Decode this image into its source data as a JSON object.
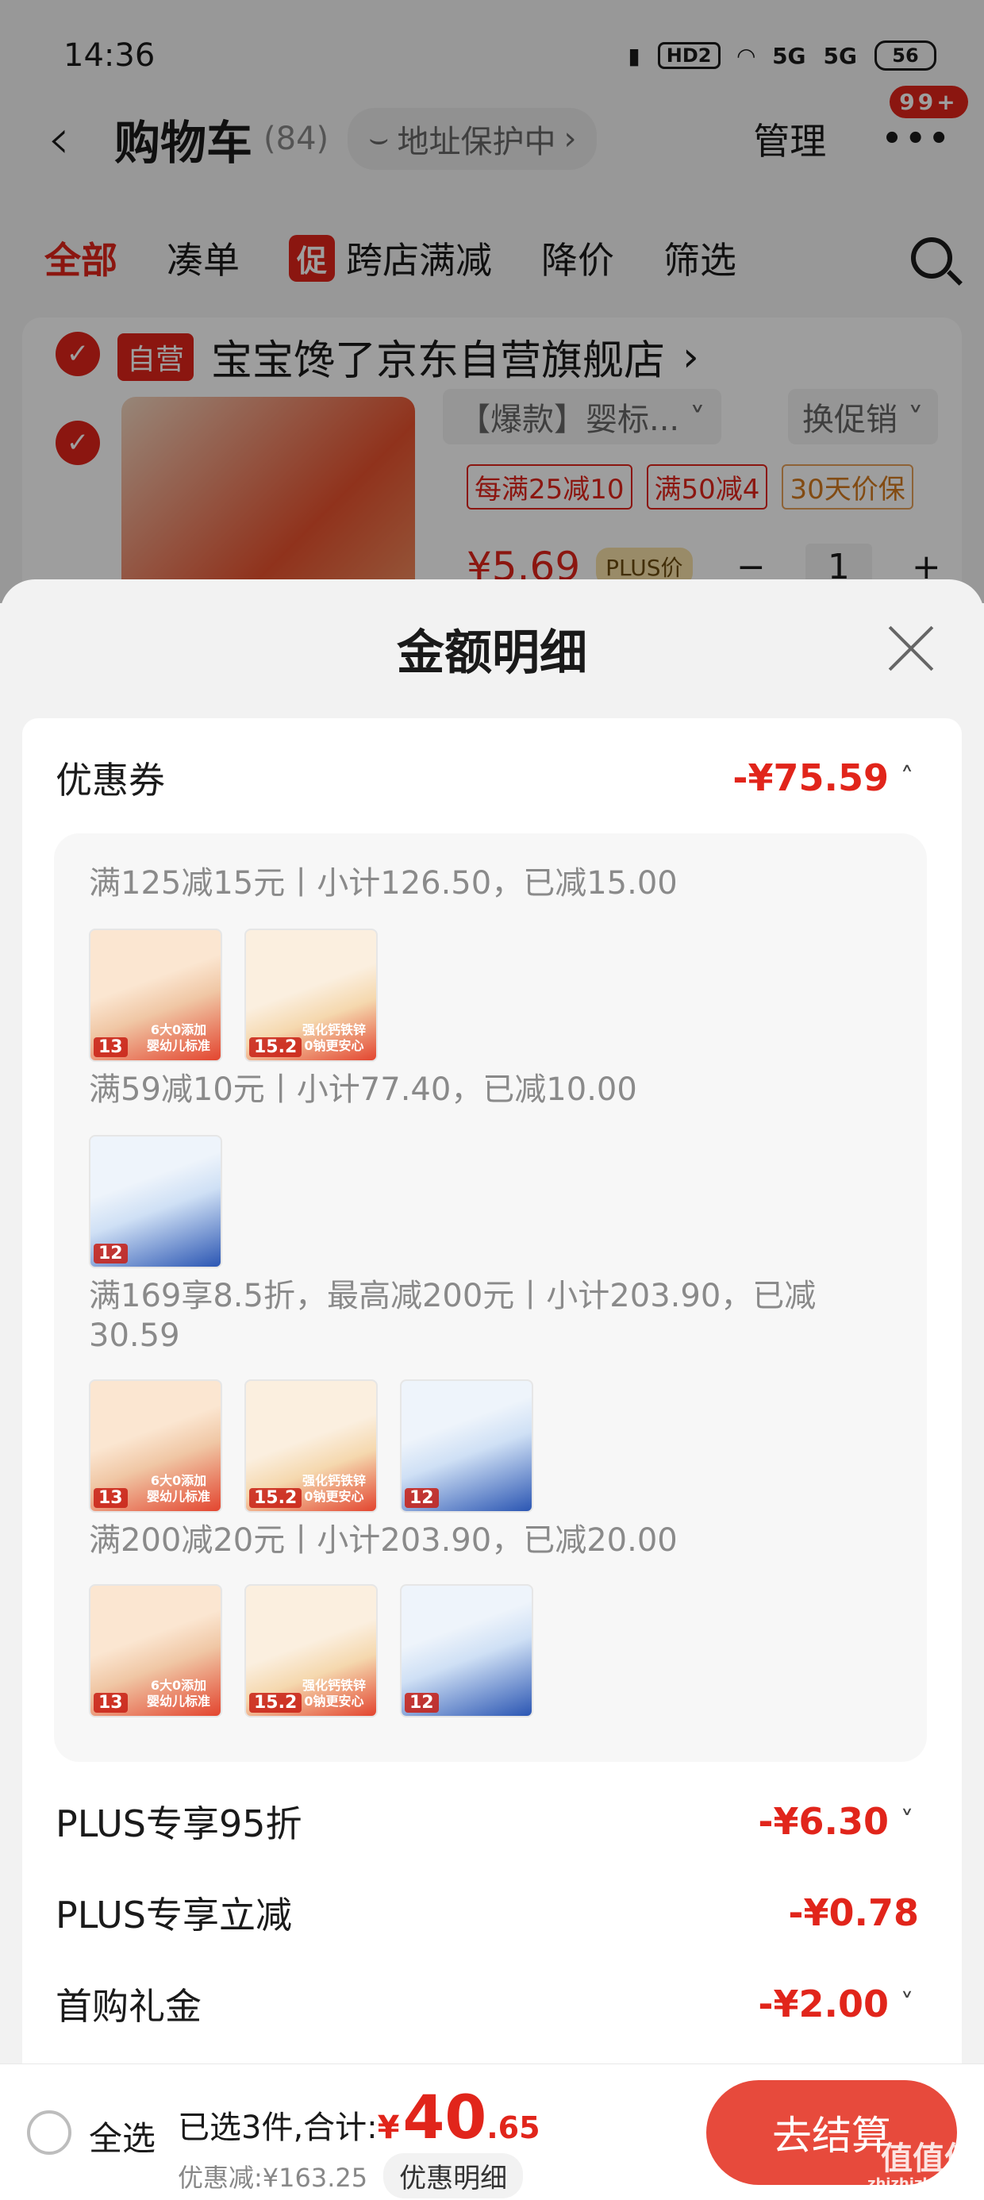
{
  "status_bar": {
    "time": "14:36",
    "hd": "HD2",
    "net1": "5G",
    "net2": "5G",
    "battery": "56"
  },
  "nav": {
    "title": "购物车",
    "count": "(84)",
    "address": "地址保护中",
    "manage": "管理",
    "badge": "99+"
  },
  "tabs": [
    {
      "label": "全部"
    },
    {
      "label": "凑单"
    },
    {
      "label": "跨店满减",
      "tag": "促"
    },
    {
      "label": "降价"
    },
    {
      "label": "筛选"
    }
  ],
  "store": {
    "self_tag": "自营",
    "name": "宝宝馋了京东自营旗舰店",
    "spec": "【爆款】婴标...",
    "swap": "换促销",
    "coupon_tags": [
      "每满25减10",
      "满50减4",
      "30天价保"
    ],
    "price": "¥5.69",
    "plus_tag": "PLUS价",
    "qty": "1"
  },
  "sheet": {
    "title": "金额明细",
    "coupon": {
      "label": "优惠券",
      "amount": "-¥75.59"
    },
    "rules": [
      {
        "text": "满125减15元丨小计126.50，已减15.00",
        "items": [
          "13",
          "15.2"
        ]
      },
      {
        "text": "满59减10元丨小计77.40，已减10.00",
        "items": [
          "12"
        ]
      },
      {
        "text": "满169享8.5折，最高减200元丨小计203.90，已减30.59",
        "items": [
          "13",
          "15.2",
          "12"
        ]
      },
      {
        "text": "满200减20元丨小计203.90，已减20.00",
        "items": [
          "13",
          "15.2",
          "12"
        ]
      }
    ],
    "thumb_text": {
      "t1": "6大0添加 婴幼儿标准",
      "t2": "强化钙铁锌 0钠更安心"
    },
    "plus_discount": {
      "label": "PLUS专享95折",
      "amount": "-¥6.30"
    },
    "plus_cut": {
      "label": "PLUS专享立减",
      "amount": "-¥0.78"
    },
    "first_gift": {
      "label": "首购礼金",
      "amount": "-¥2.00"
    }
  },
  "bottom": {
    "select_all": "全选",
    "selected_text": "已选3件,合计:",
    "currency": "¥",
    "total_int": "40",
    "total_dec": ".65",
    "saving": "优惠减:¥163.25",
    "detail_btn": "优惠明细",
    "checkout": "去结算"
  },
  "watermark": {
    "main": "值值值",
    "sub": "zhizhizhi.com"
  },
  "colors": {
    "accent": "#e1251b",
    "checkout": "#e74a3c"
  }
}
